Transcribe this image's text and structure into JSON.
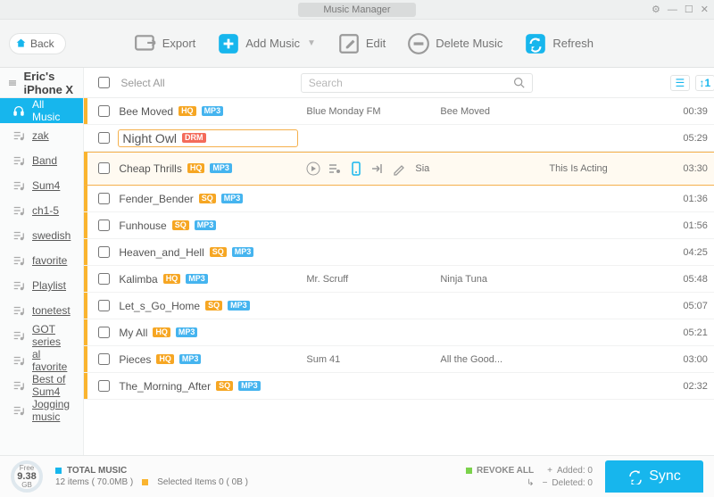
{
  "window": {
    "title": "Music Manager"
  },
  "toolbar": {
    "back": "Back",
    "export": "Export",
    "add": "Add Music",
    "edit": "Edit",
    "delete": "Delete Music",
    "refresh": "Refresh"
  },
  "device": {
    "name": "Eric's iPhone X"
  },
  "sidebar": {
    "items": [
      {
        "label": "All Music",
        "icon": "headphones",
        "active": true
      },
      {
        "label": "zak",
        "icon": "playlist"
      },
      {
        "label": "Band",
        "icon": "playlist"
      },
      {
        "label": "Sum4",
        "icon": "playlist"
      },
      {
        "label": "ch1-5",
        "icon": "playlist"
      },
      {
        "label": "swedish",
        "icon": "playlist"
      },
      {
        "label": "favorite",
        "icon": "playlist"
      },
      {
        "label": "Playlist",
        "icon": "playlist"
      },
      {
        "label": "tonetest",
        "icon": "playlist"
      },
      {
        "label": "GOT series",
        "icon": "playlist"
      },
      {
        "label": "al favorite",
        "icon": "playlist"
      },
      {
        "label": "Best of Sum4",
        "icon": "playlist"
      },
      {
        "label": "Jogging music",
        "icon": "playlist"
      }
    ]
  },
  "header": {
    "selectAll": "Select All",
    "searchPlaceholder": "Search"
  },
  "tracks": [
    {
      "title": "Bee Moved",
      "badges": [
        "HQ",
        "MP3"
      ],
      "artist": "Blue Monday FM",
      "album": "Bee Moved",
      "dur": "00:39",
      "bar": true
    },
    {
      "title": "Night Owl",
      "badges": [
        "DRM"
      ],
      "artist": "",
      "album": "",
      "dur": "05:29",
      "boxed": true
    },
    {
      "title": "Cheap Thrills",
      "badges": [
        "HQ",
        "MP3"
      ],
      "artist": "Sia",
      "album": "This Is Acting",
      "dur": "03:30",
      "hl": true,
      "bar": true,
      "actions": true,
      "trash": true
    },
    {
      "title": "Fender_Bender",
      "badges": [
        "SQ",
        "MP3"
      ],
      "artist": "",
      "album": "",
      "dur": "01:36",
      "bar": true
    },
    {
      "title": "Funhouse",
      "badges": [
        "SQ",
        "MP3"
      ],
      "artist": "",
      "album": "",
      "dur": "01:56",
      "bar": true
    },
    {
      "title": "Heaven_and_Hell",
      "badges": [
        "SQ",
        "MP3"
      ],
      "artist": "",
      "album": "",
      "dur": "04:25",
      "bar": true
    },
    {
      "title": "Kalimba",
      "badges": [
        "HQ",
        "MP3"
      ],
      "artist": "Mr. Scruff",
      "album": "Ninja Tuna",
      "dur": "05:48",
      "bar": true
    },
    {
      "title": "Let_s_Go_Home",
      "badges": [
        "SQ",
        "MP3"
      ],
      "artist": "",
      "album": "",
      "dur": "05:07",
      "bar": true
    },
    {
      "title": "My All",
      "badges": [
        "HQ",
        "MP3"
      ],
      "artist": "",
      "album": "",
      "dur": "05:21",
      "bar": true
    },
    {
      "title": "Pieces",
      "badges": [
        "HQ",
        "MP3"
      ],
      "artist": "Sum 41",
      "album": "All the Good...",
      "dur": "03:00",
      "bar": true
    },
    {
      "title": "The_Morning_After",
      "badges": [
        "SQ",
        "MP3"
      ],
      "artist": "",
      "album": "",
      "dur": "02:32",
      "bar": true
    }
  ],
  "footer": {
    "disk_free_label": "Free",
    "disk_free_value": "9.38",
    "disk_free_unit": "GB",
    "total_label": "TOTAL MUSIC",
    "total_detail": "12 items ( 70.0MB )",
    "selected": "Selected Items 0 ( 0B )",
    "revoke": "REVOKE ALL",
    "added": "Added: 0",
    "deleted": "Deleted: 0",
    "sync": "Sync"
  },
  "colors": {
    "accent": "#17b6ed",
    "orange": "#f6a623"
  }
}
